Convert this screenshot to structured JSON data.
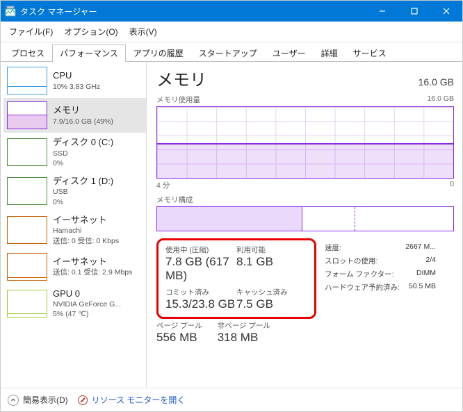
{
  "window": {
    "title": "タスク マネージャー"
  },
  "menubar": [
    "ファイル(F)",
    "オプション(O)",
    "表示(V)"
  ],
  "tabs": [
    "プロセス",
    "パフォーマンス",
    "アプリの履歴",
    "スタートアップ",
    "ユーザー",
    "詳細",
    "サービス"
  ],
  "active_tab": 1,
  "sidebar": {
    "items": [
      {
        "title": "CPU",
        "sub": "10%  3.83 GHz"
      },
      {
        "title": "メモリ",
        "sub": "7.9/16.0 GB (49%)"
      },
      {
        "title": "ディスク 0 (C:)",
        "sub": "SSD\n0%"
      },
      {
        "title": "ディスク 1 (D:)",
        "sub": "USB\n0%"
      },
      {
        "title": "イーサネット",
        "sub": "Hamachi\n送信: 0 受信: 0 Kbps"
      },
      {
        "title": "イーサネット",
        "sub": "送信: 0.1 受信: 2.9 Mbps"
      },
      {
        "title": "GPU 0",
        "sub": "NVIDIA GeForce G...\n5%  (47 ℃)"
      }
    ],
    "selected": 1
  },
  "page": {
    "title": "メモリ",
    "capacity": "16.0 GB",
    "usage_label": "メモリ使用量",
    "usage_max": "16.0 GB",
    "time_left": "4 分",
    "time_right": "0",
    "composition_label": "メモリ構成",
    "stats": {
      "in_use_label": "使用中 (圧縮)",
      "in_use_value": "7.8 GB (617 MB)",
      "available_label": "利用可能",
      "available_value": "8.1 GB",
      "committed_label": "コミット済み",
      "committed_value": "15.3/23.8 GB",
      "cached_label": "キャッシュ済み",
      "cached_value": "7.5 GB",
      "paged_label": "ページ プール",
      "paged_value": "556 MB",
      "nonpaged_label": "非ページ プール",
      "nonpaged_value": "318 MB"
    },
    "props": {
      "speed_label": "速度:",
      "speed_value": "2667 M...",
      "slots_label": "スロットの使用:",
      "slots_value": "2/4",
      "form_label": "フォーム ファクター:",
      "form_value": "DIMM",
      "reserved_label": "ハードウェア予約済み:",
      "reserved_value": "50.5 MB"
    }
  },
  "footer": {
    "fewer": "簡易表示(D)",
    "resmon": "リソース モニターを開く"
  },
  "chart_data": {
    "type": "area",
    "title": "メモリ使用量",
    "ylabel": "GB",
    "ylim": [
      0,
      16
    ],
    "xlabel_left": "4 分",
    "xlabel_right": "0",
    "series": [
      {
        "name": "使用中",
        "value_gb": 7.9,
        "fraction": 0.494
      }
    ],
    "composition": {
      "in_use_fraction": 0.49,
      "standby_fraction": 0.18
    }
  }
}
